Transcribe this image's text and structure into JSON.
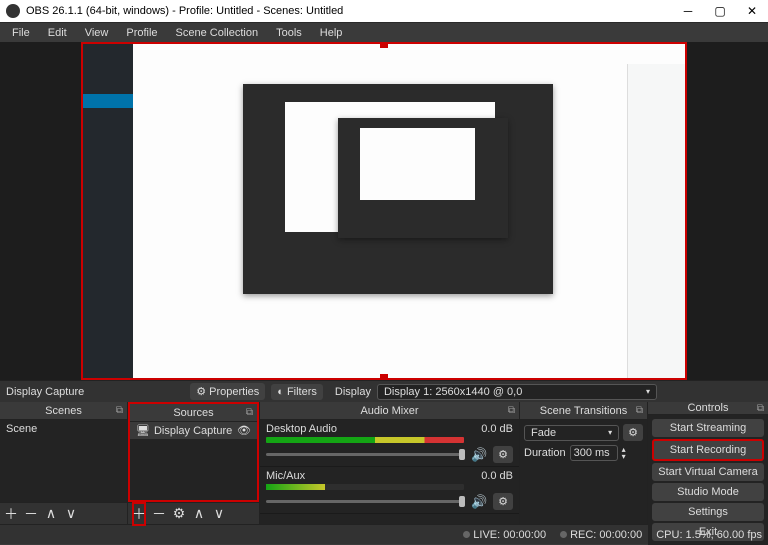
{
  "window": {
    "title": "OBS 26.1.1 (64-bit, windows) - Profile: Untitled - Scenes: Untitled"
  },
  "menu": {
    "file": "File",
    "edit": "Edit",
    "view": "View",
    "profile": "Profile",
    "scene_collection": "Scene Collection",
    "tools": "Tools",
    "help": "Help"
  },
  "source_bar": {
    "selected_label": "Display Capture",
    "properties": "Properties",
    "filters": "Filters",
    "display_label": "Display",
    "display_value": "Display 1: 2560x1440 @ 0,0"
  },
  "panels": {
    "scenes": {
      "title": "Scenes",
      "items": [
        "Scene"
      ]
    },
    "sources": {
      "title": "Sources",
      "items": [
        {
          "icon": "monitor-icon",
          "label": "Display Capture"
        }
      ]
    },
    "mixer": {
      "title": "Audio Mixer",
      "tracks": [
        {
          "name": "Desktop Audio",
          "level": "0.0 dB"
        },
        {
          "name": "Mic/Aux",
          "level": "0.0 dB"
        }
      ]
    },
    "transitions": {
      "title": "Scene Transitions",
      "type": "Fade",
      "duration_label": "Duration",
      "duration_value": "300 ms"
    },
    "controls": {
      "title": "Controls",
      "start_streaming": "Start Streaming",
      "start_recording": "Start Recording",
      "start_virtual_camera": "Start Virtual Camera",
      "studio_mode": "Studio Mode",
      "settings": "Settings",
      "exit": "Exit"
    }
  },
  "status": {
    "live": "LIVE: 00:00:00",
    "rec": "REC: 00:00:00",
    "cpu": "CPU: 1.5%, 60.00 fps"
  }
}
